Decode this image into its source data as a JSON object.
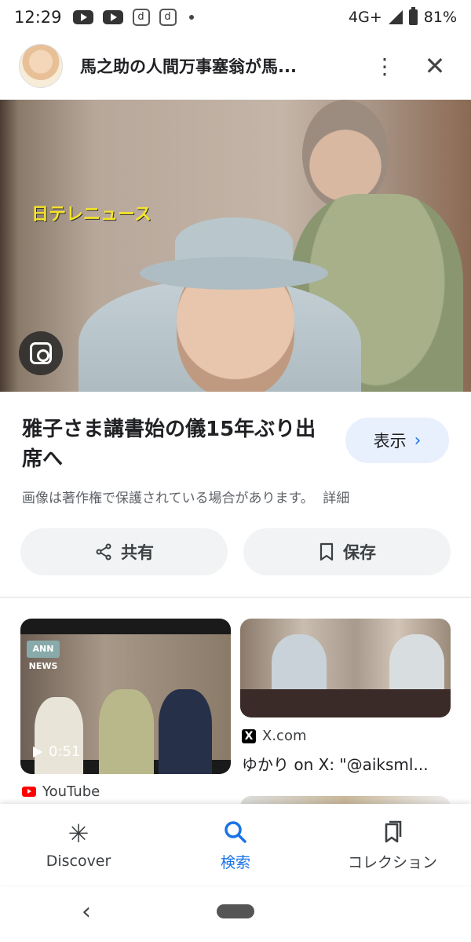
{
  "status_bar": {
    "time": "12:29",
    "notification_icons": [
      "youtube-icon",
      "youtube-icon",
      "d-app-icon",
      "d-app-icon"
    ],
    "network": "4G+",
    "battery": "81%"
  },
  "header": {
    "title": "馬之助の人間万事塞翁が馬...",
    "more_icon": "⋮",
    "close_icon": "✕"
  },
  "main_image": {
    "overlay_text": "日テレニュース"
  },
  "result": {
    "title": "雅子さま講書始の儀15年ぶり出席へ",
    "visit_label": "表示",
    "visit_arrow": "›",
    "copyright_notice": "画像は著作権で保護されている場合があります。",
    "details_link": "詳細"
  },
  "actions": {
    "share_label": "共有",
    "save_label": "保存"
  },
  "related": [
    {
      "badge": "ANN NEWS",
      "duration": "0:51",
      "source": "YouTube"
    },
    {
      "source": "X.com",
      "title": "ゆかり on X: \"@aiksml..."
    }
  ],
  "bottom_nav": [
    {
      "icon": "✳",
      "label": "Discover"
    },
    {
      "icon": "🔍",
      "label": "検索"
    },
    {
      "icon": "⧉",
      "label": "コレクション"
    }
  ],
  "system_nav": {
    "back_icon": "‹"
  },
  "colors": {
    "accent": "#1a73e8",
    "visit_bg": "#e8f0fe",
    "button_bg": "#f1f3f4"
  }
}
